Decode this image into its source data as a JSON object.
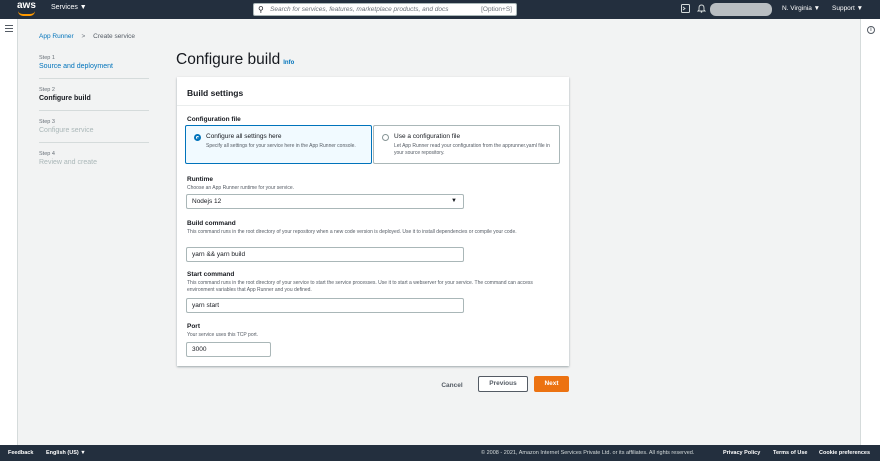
{
  "topnav": {
    "logo": "aws",
    "services": "Services ▼",
    "search_placeholder": "Search for services, features, marketplace products, and docs",
    "search_shortcut": "[Option+S]",
    "region": "N. Virginia ▼",
    "support": "Support ▼"
  },
  "breadcrumb": {
    "root": "App Runner",
    "separator": ">",
    "current": "Create service"
  },
  "steps": [
    {
      "num": "Step 1",
      "label": "Source and deployment",
      "state": "done"
    },
    {
      "num": "Step 2",
      "label": "Configure build",
      "state": "active"
    },
    {
      "num": "Step 3",
      "label": "Configure service",
      "state": "todo"
    },
    {
      "num": "Step 4",
      "label": "Review and create",
      "state": "todo"
    }
  ],
  "page": {
    "title": "Configure build",
    "info": "Info"
  },
  "panel": {
    "heading": "Build settings",
    "config_file": {
      "label": "Configuration file",
      "option_here_title": "Configure all settings here",
      "option_here_desc": "Specify all settings for your service here in the App Runner console.",
      "option_file_title": "Use a configuration file",
      "option_file_desc": "Let App Runner read your configuration from the apprunner.yaml file in your source repository."
    },
    "runtime": {
      "label": "Runtime",
      "desc": "Choose an App Runner runtime for your service.",
      "value": "Nodejs 12"
    },
    "build_command": {
      "label": "Build command",
      "desc": "This command runs in the root directory of your repository when a new code version is deployed. Use it to install dependencies or compile your code.",
      "value": "yarn && yarn build"
    },
    "start_command": {
      "label": "Start command",
      "desc": "This command runs in the root directory of your service to start the service processes. Use it to start a webserver for your service. The command can access environment variables that App Runner and you defined.",
      "value": "yarn start"
    },
    "port": {
      "label": "Port",
      "desc": "Your service uses this TCP port.",
      "value": "3000"
    }
  },
  "actions": {
    "cancel": "Cancel",
    "previous": "Previous",
    "next": "Next"
  },
  "footer": {
    "feedback": "Feedback",
    "language": "English (US) ▼",
    "copyright": "© 2008 - 2021, Amazon Internet Services Private Ltd. or its affiliates. All rights reserved.",
    "privacy": "Privacy Policy",
    "terms": "Terms of Use",
    "cookies": "Cookie preferences"
  },
  "colors": {
    "nav_bg": "#232f3e",
    "link": "#0073bb",
    "primary": "#ec7211"
  }
}
